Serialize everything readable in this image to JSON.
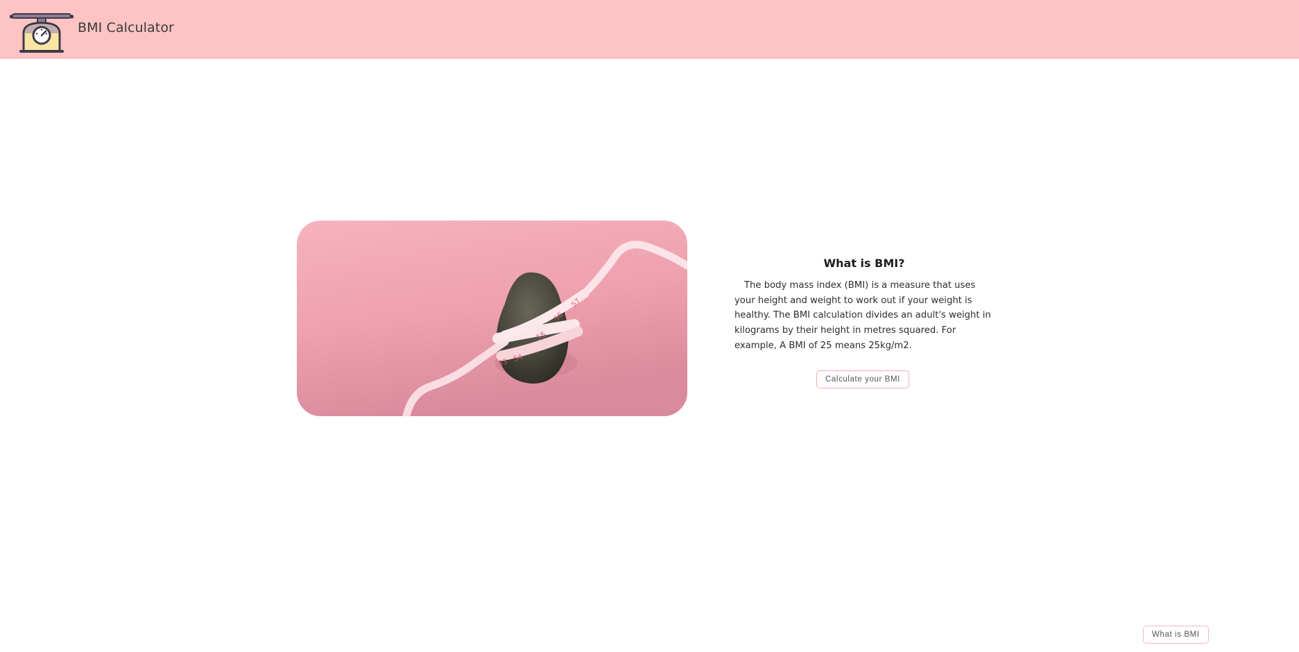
{
  "header": {
    "logo_icon": "kitchen-scale-icon",
    "title": "BMI Calculator",
    "background_color": "#fec3c3"
  },
  "hero": {
    "image": "avocado-with-measuring-tape",
    "tape_labels": [
      "53",
      "54",
      "55",
      "56",
      "57"
    ]
  },
  "info": {
    "heading": "What is BMI?",
    "body": "The body mass index (BMI) is a measure that uses your height and weight to work out if your weight is healthy. The BMI calculation divides an adult's weight in kilograms by their height in metres squared. For example, A BMI of 25 means 25kg/m2.",
    "cta_label": "Calculate your BMI"
  },
  "footer": {
    "what_is_bmi_label": "What is BMI"
  },
  "colors": {
    "accent_border": "#f4aab2",
    "image_pink": "#f0a5b2"
  }
}
